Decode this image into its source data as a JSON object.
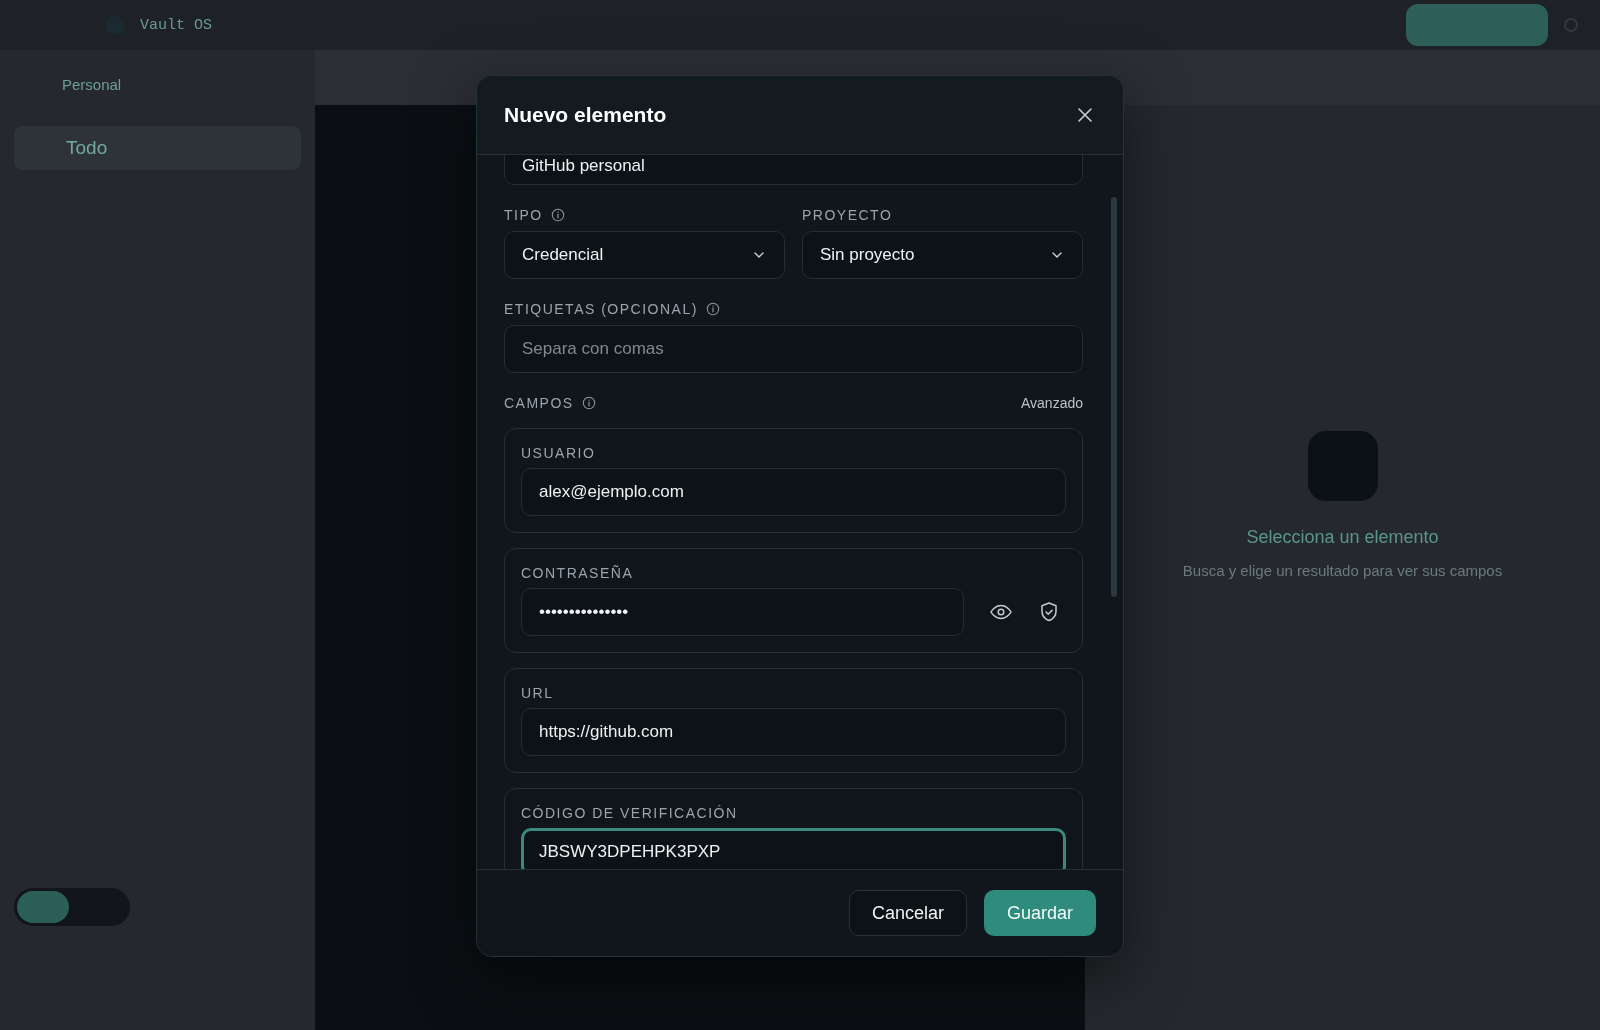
{
  "app": {
    "logo": "Vault OS",
    "vault": "Personal",
    "nav": [
      {
        "label": "Todo",
        "selected": true
      }
    ],
    "empty_state": {
      "title": "Selecciona un elemento",
      "text": "Busca y elige un resultado para ver sus campos"
    }
  },
  "dialog": {
    "title": "Nuevo elemento",
    "name_value": "GitHub personal",
    "tipo": {
      "label": "TIPO",
      "value": "Credencial"
    },
    "proyecto": {
      "label": "PROYECTO",
      "value": "Sin proyecto"
    },
    "etiquetas": {
      "label": "ETIQUETAS (OPCIONAL)",
      "placeholder": "Separa con comas"
    },
    "campos": {
      "label": "CAMPOS",
      "advanced": "Avanzado"
    },
    "fields": [
      {
        "kind": "text",
        "label": "USUARIO",
        "value": "alex@ejemplo.com",
        "focused": false
      },
      {
        "kind": "password",
        "label": "CONTRASEÑA",
        "value": "•••••••••••••••",
        "focused": false
      },
      {
        "kind": "text",
        "label": "URL",
        "value": "https://github.com",
        "focused": false
      },
      {
        "kind": "text",
        "label": "CÓDIGO DE VERIFICACIÓN",
        "value": "JBSWY3DPEHPK3PXP",
        "focused": true
      }
    ],
    "buttons": {
      "cancel": "Cancelar",
      "save": "Guardar"
    }
  }
}
